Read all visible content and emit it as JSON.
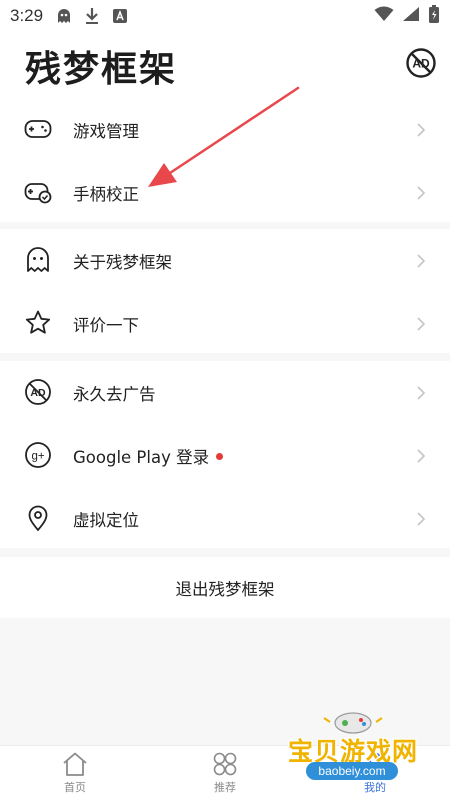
{
  "status": {
    "time": "3:29"
  },
  "header": {
    "title": "残梦框架",
    "ad_icon_text": "AD"
  },
  "group1": [
    {
      "label": "游戏管理",
      "icon": "gamepad-icon"
    },
    {
      "label": "手柄校正",
      "icon": "controller-calibrate-icon"
    }
  ],
  "group2": [
    {
      "label": "关于残梦框架",
      "icon": "ghost-icon"
    },
    {
      "label": "评价一下",
      "icon": "star-icon"
    }
  ],
  "group3": [
    {
      "label": "永久去广告",
      "icon": "no-ad-icon",
      "icon_text": "AD"
    },
    {
      "label": "Google Play 登录",
      "icon": "google-plus-icon",
      "icon_text": "g+",
      "badge_color": "#e53935"
    },
    {
      "label": "虚拟定位",
      "icon": "location-pin-icon"
    }
  ],
  "exit_label": "退出残梦框架",
  "tabs": [
    {
      "label": "首页",
      "icon": "home-icon"
    },
    {
      "label": "推荐",
      "icon": "recommend-icon"
    },
    {
      "label": "我的",
      "icon": "profile-icon",
      "active": true
    }
  ],
  "watermark": {
    "text": "宝贝游戏网",
    "url": "baobeiy.com"
  },
  "colors": {
    "accent": "#3a72d8",
    "arrow": "#e8474c",
    "badge": "#e53935",
    "watermark": "#f0b400"
  }
}
